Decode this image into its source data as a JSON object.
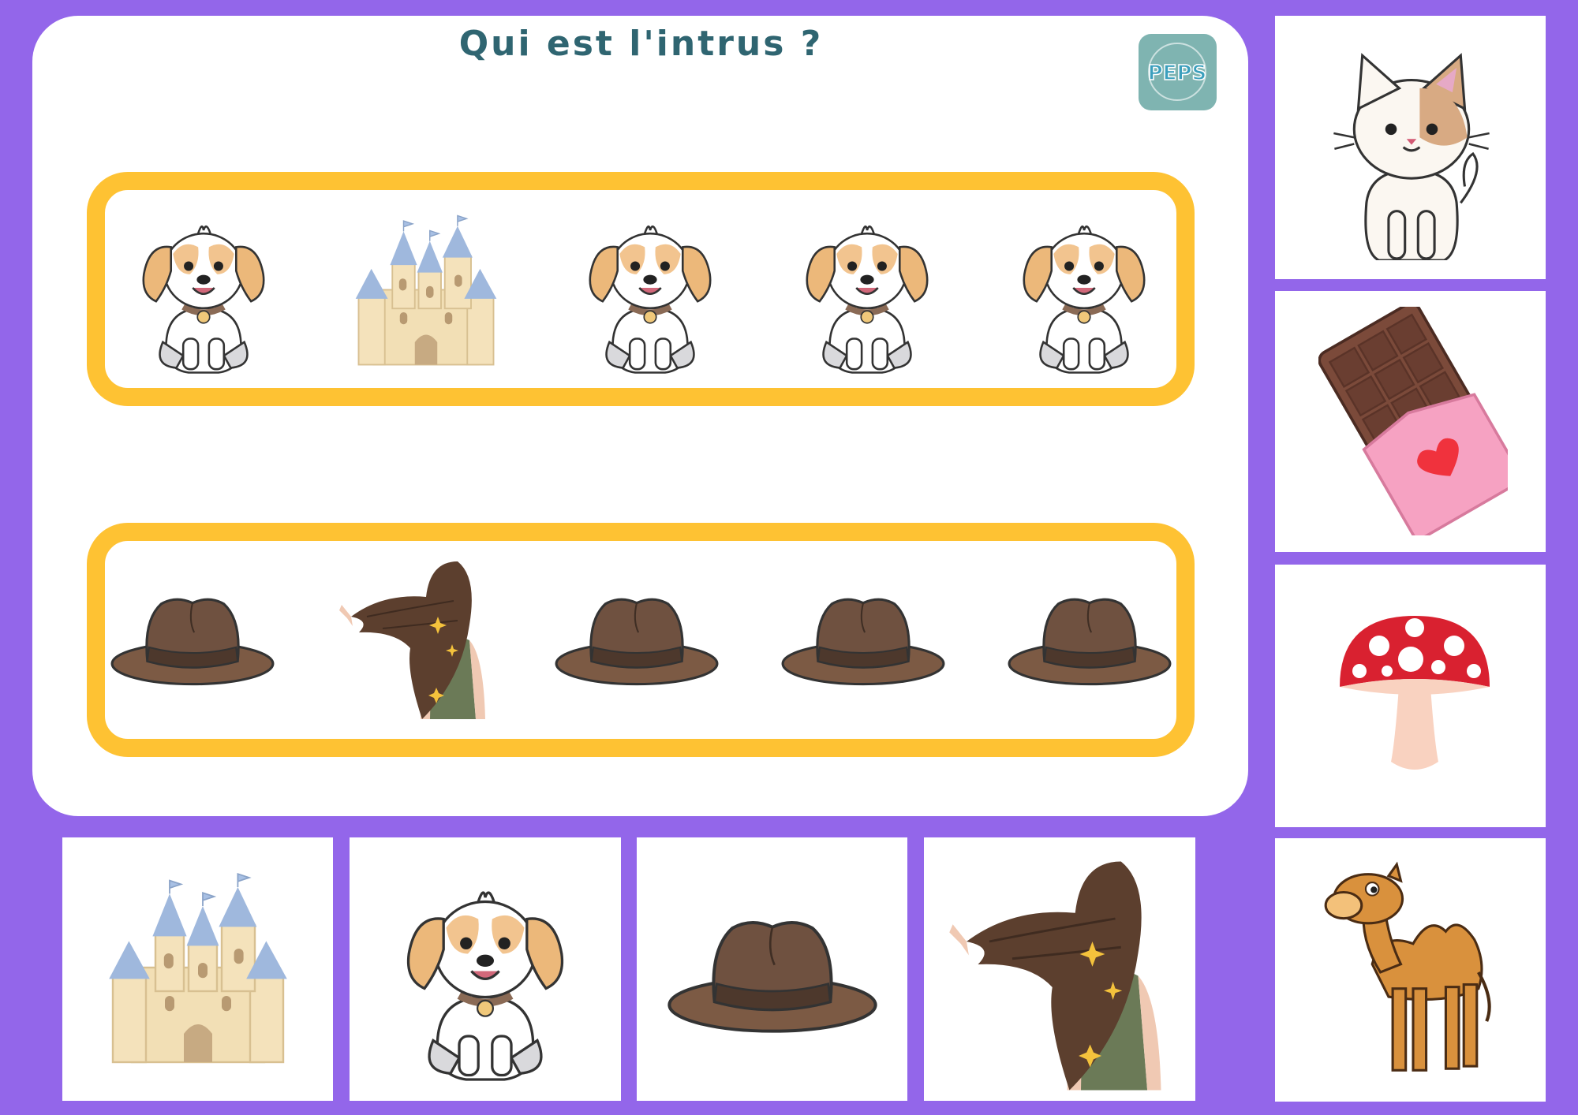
{
  "title": "Qui est l'intrus ?",
  "logo": {
    "text": "PEPS",
    "icon": "peps-logo"
  },
  "colors": {
    "background": "#9366ea",
    "frame": "#fec233",
    "title": "#2f6571"
  },
  "rows": [
    {
      "items": [
        "dog",
        "castle",
        "dog",
        "dog",
        "dog"
      ],
      "odd_index": 1
    },
    {
      "items": [
        "hat",
        "hair",
        "hat",
        "hat",
        "hat"
      ],
      "odd_index": 1
    }
  ],
  "answer_cards_bottom": [
    "castle",
    "dog",
    "hat",
    "hair"
  ],
  "answer_cards_side": [
    "cat",
    "chocolate",
    "mushroom",
    "camel"
  ]
}
